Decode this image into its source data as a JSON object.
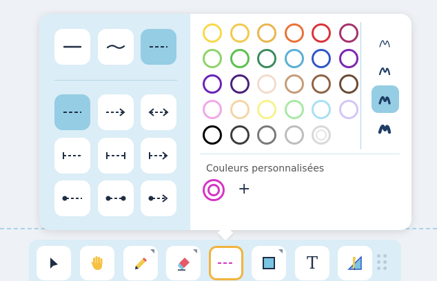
{
  "line_styles": {
    "stroke_types": [
      "solid",
      "wavy",
      "dashed"
    ],
    "selected_stroke": "dashed",
    "arrow_types": [
      "dashed-plain",
      "dashed-arrow-end",
      "dashed-arrow-both",
      "bar-start",
      "bar-both",
      "bar-arrow",
      "dot-start",
      "dot-both",
      "dot-arrow"
    ],
    "selected_arrow": "dashed-plain"
  },
  "palette": {
    "rows": [
      [
        "#f6d94a",
        "#f2c94c",
        "#e9b54c",
        "#ea7338",
        "#d9333a",
        "#a3336c"
      ],
      [
        "#8fd36b",
        "#5dbf4f",
        "#3a8a5c",
        "#5aaed6",
        "#2f56c8",
        "#7a27b0"
      ],
      [
        "#6a23b5",
        "#4a1f7a",
        "#f2dccd",
        "#c59c78",
        "#8f6244",
        "#6b4a34"
      ],
      [
        "#f0a8e6",
        "#f3d5a6",
        "#f7f28e",
        "#a9e9a5",
        "#a8dff4",
        "#d3c6f4"
      ],
      [
        "#000000",
        "#3d3d3d",
        "#7a7a7a",
        "#bdbdbd",
        "#e0e0e0"
      ]
    ],
    "custom_label": "Couleurs personnalisées",
    "custom_colors": [
      "#d634c4"
    ],
    "add_label": "+"
  },
  "pen_widths": [
    "thin",
    "medium",
    "thick",
    "extra-thick"
  ],
  "selected_pen_width": "thick",
  "toolbar": {
    "tools": [
      "select",
      "hand",
      "pencil",
      "eraser",
      "line",
      "shape",
      "text",
      "ruler"
    ],
    "selected_tool": "line",
    "text_tool_label": "T"
  },
  "colors": {
    "accent": "#94cde4",
    "panel": "#dbedf6",
    "icon": "#1f2e45",
    "selected_border": "#f2b33d"
  }
}
